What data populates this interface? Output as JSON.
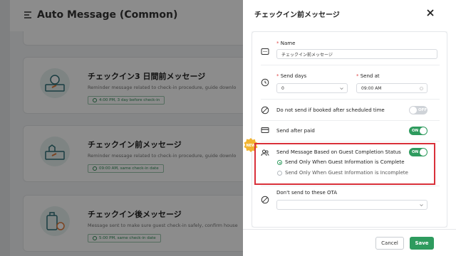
{
  "background": {
    "page_title": "Auto Message (Common)",
    "cards": [
      {
        "title": "チェックイン3 日間前メッセージ",
        "description": "Reminder message related to check-in procedure, guide downlo",
        "schedule": "4:00 PM, 3 day before check-in"
      },
      {
        "title": "チェックイン前メッセージ",
        "description": "Reminder message related to check-in procedure, guide downlo",
        "schedule": "09:00 AM, same check-in date"
      },
      {
        "title": "チェックイン後メッセージ",
        "description": "Message sent to make sure guest check-in safely, confirm house",
        "schedule": "5:00 PM, same check-in date"
      }
    ]
  },
  "drawer": {
    "title": "チェックイン前メッセージ",
    "name": {
      "label": "Name",
      "value": "チェックイン前メッセージ"
    },
    "send_days": {
      "label": "Send days",
      "value": "0"
    },
    "send_at": {
      "label": "Send at",
      "value": "09:00 AM"
    },
    "do_not_send": {
      "label": "Do not send if booked after scheduled time",
      "toggle": "OFF"
    },
    "send_after_paid": {
      "label": "Send after paid",
      "toggle": "ON"
    },
    "guest_completion": {
      "badge": "NEW",
      "label": "Send Message Based on Guest Completion Status",
      "toggle": "ON",
      "options": [
        {
          "label": "Send Only When Guest Information is Complete",
          "checked": true
        },
        {
          "label": "Send Only When Guest Information is Incomplete",
          "checked": false
        }
      ]
    },
    "ota": {
      "label": "Don't send to these OTA",
      "value": ""
    },
    "cancel_label": "Cancel",
    "save_label": "Save"
  },
  "colors": {
    "accent": "#2e9b5e",
    "highlight": "#d9303a",
    "required": "#e04848"
  }
}
